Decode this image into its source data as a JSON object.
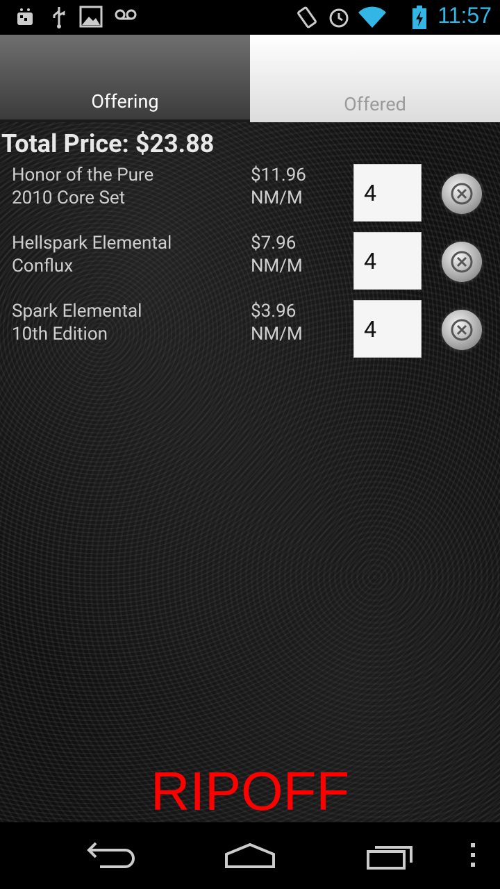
{
  "status_bar": {
    "time": "11:57",
    "icons": [
      "android-debug-icon",
      "usb-icon",
      "image-icon",
      "voicemail-icon",
      "rotation-icon",
      "alarm-icon",
      "wifi-icon",
      "battery-charging-icon"
    ]
  },
  "tabs": [
    {
      "label": "Offering",
      "active": true
    },
    {
      "label": "Offered",
      "active": false
    }
  ],
  "total_price": "Total Price: $23.88",
  "items": [
    {
      "name": "Honor of the Pure",
      "set": "2010 Core Set",
      "price": "$11.96",
      "condition": "NM/M",
      "quantity": "4"
    },
    {
      "name": "Hellspark Elemental",
      "set": "Conflux",
      "price": "$7.96",
      "condition": "NM/M",
      "quantity": "4"
    },
    {
      "name": "Spark Elemental",
      "set": "10th Edition",
      "price": "$3.96",
      "condition": "NM/M",
      "quantity": "4"
    }
  ],
  "verdict": {
    "text": "RIPOFF",
    "color": "#ff0000"
  },
  "nav": [
    "back-icon",
    "home-icon",
    "recent-apps-icon",
    "overflow-menu-icon"
  ],
  "colors": {
    "accent_time": "#33b5e5"
  }
}
